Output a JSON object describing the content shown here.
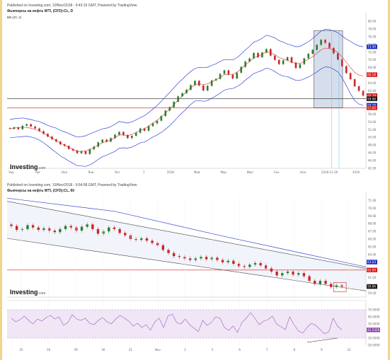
{
  "chart_data": [
    {
      "type": "candlestick",
      "published": "Published on Investing.com, 10/Nov/2018 - 9:43:16 GMT, Powered by TradingView",
      "title": "Фьючерсы на нефть WTI, (CFD):CL, D",
      "indicator": "BB (20, 2)",
      "logo": "Investing",
      "logo_suffix": ".com",
      "ylim": [
        42,
        80
      ],
      "y_ticks": [
        "80.00",
        "78.00",
        "76.00",
        "74.00",
        "72.00",
        "70.00",
        "68.00",
        "66.00",
        "64.00",
        "62.00",
        "60.00",
        "58.00",
        "56.00",
        "54.00",
        "52.00",
        "50.00",
        "48.00",
        "46.00",
        "44.00",
        "42.00"
      ],
      "x_ticks": [
        "Sep",
        "Авг",
        "Ноя",
        "Янв",
        "Окт",
        "7",
        "2018",
        "Май",
        "Мар",
        "Июл",
        "Сен",
        "Ноя",
        "2018-11-26",
        "2019"
      ],
      "price_labels": [
        {
          "text": "73.40",
          "value": 73.4,
          "color": "#1c2ec9"
        },
        {
          "text": "66.18",
          "value": 66.2,
          "color": "#d81b1b"
        },
        {
          "text": "60.78",
          "value": 60.78,
          "color": "#d81b1b"
        },
        {
          "text": "59.96",
          "value": 59.96,
          "color": "#111111"
        },
        {
          "text": "58.28",
          "value": 58.3,
          "color": "#1c2ec9"
        },
        {
          "text": "57.65",
          "value": 57.65,
          "color": "#d81b1b"
        }
      ],
      "horizontal_lines": [
        {
          "value": 59.96,
          "color": "#222222"
        },
        {
          "value": 57.65,
          "color": "#d81b1b"
        }
      ],
      "highlight_box": {
        "x_range": [
          0.855,
          0.935
        ],
        "y_range": [
          57.6,
          77.6
        ],
        "color": "#8aa1c7"
      },
      "closes": [
        52.2,
        52.6,
        52.1,
        53.0,
        53.4,
        52.8,
        52.3,
        51.6,
        50.9,
        50.2,
        49.5,
        48.9,
        48.2,
        47.8,
        47.0,
        46.6,
        45.9,
        46.4,
        45.7,
        46.9,
        47.6,
        48.7,
        49.4,
        48.9,
        49.8,
        50.7,
        51.4,
        50.6,
        49.8,
        50.4,
        51.2,
        52.3,
        51.7,
        52.9,
        53.6,
        54.3,
        55.5,
        56.9,
        57.8,
        59.2,
        60.6,
        61.4,
        62.3,
        63.5,
        64.6,
        63.4,
        62.1,
        63.3,
        64.7,
        65.1,
        66.4,
        67.3,
        66.2,
        65.2,
        66.7,
        68.2,
        69.6,
        70.4,
        71.8,
        70.7,
        71.9,
        72.8,
        71.1,
        70.0,
        68.9,
        69.9,
        70.7,
        69.3,
        67.9,
        68.9,
        70.4,
        71.6,
        72.6,
        73.9,
        75.2,
        74.4,
        73.1,
        71.7,
        70.1,
        68.4,
        66.6,
        65.0,
        63.2,
        62.0,
        60.78
      ],
      "bb_upper": [
        54.6,
        54.8,
        54.9,
        55.0,
        54.8,
        54.6,
        54.3,
        54.1,
        53.6,
        53.1,
        52.7,
        52.4,
        51.8,
        51.4,
        51.0,
        50.5,
        50.1,
        50.2,
        50.4,
        50.9,
        51.3,
        51.8,
        52.2,
        52.4,
        52.8,
        53.4,
        54.1,
        53.9,
        53.7,
        54.0,
        54.5,
        55.1,
        55.6,
        56.4,
        57.3,
        58.2,
        59.3,
        60.5,
        61.6,
        62.8,
        64.0,
        65.0,
        66.1,
        67.0,
        67.8,
        68.1,
        68.0,
        68.1,
        68.6,
        69.0,
        69.6,
        70.1,
        70.0,
        70.0,
        70.6,
        71.5,
        72.6,
        73.5,
        74.6,
        75.0,
        75.6,
        76.4,
        76.1,
        75.7,
        75.0,
        74.6,
        74.1,
        73.8,
        73.4,
        73.5,
        74.1,
        74.7,
        75.5,
        76.5,
        77.5,
        77.9,
        77.8,
        77.5,
        77.0,
        76.2,
        75.4,
        74.8,
        74.1,
        73.6,
        73.4
      ],
      "bb_lower": [
        49.9,
        50.0,
        50.1,
        50.2,
        50.3,
        50.1,
        49.8,
        49.3,
        48.6,
        47.8,
        46.9,
        46.1,
        45.2,
        44.6,
        43.9,
        43.3,
        42.7,
        42.6,
        42.5,
        42.9,
        43.5,
        44.3,
        45.0,
        45.4,
        45.9,
        46.4,
        47.2,
        47.3,
        47.2,
        47.5,
        48.0,
        48.6,
        48.8,
        49.4,
        50.1,
        50.6,
        51.3,
        52.1,
        53.0,
        54.1,
        55.3,
        56.4,
        57.4,
        58.5,
        59.4,
        59.5,
        59.3,
        59.5,
        60.1,
        60.7,
        61.4,
        62.2,
        62.5,
        62.6,
        63.1,
        63.8,
        64.8,
        65.6,
        66.5,
        66.9,
        67.3,
        67.9,
        67.6,
        67.0,
        66.3,
        65.8,
        65.7,
        65.2,
        64.7,
        64.7,
        65.1,
        65.6,
        66.2,
        66.9,
        67.7,
        68.2,
        68.1,
        67.6,
        66.9,
        65.4,
        63.4,
        61.3,
        59.5,
        58.6,
        58.28
      ]
    },
    {
      "type": "candlestick",
      "published": "Published on Investing.com, 10/Nov/2018 - 9:54:58 GMT, Powered by TradingView",
      "title": "Фьючерсы на нефть WTI, (CFD):CL, 60",
      "logo": "Investing",
      "logo_suffix": ".com",
      "ylim": [
        58.5,
        71.5
      ],
      "y_ticks": [
        "71.00",
        "70.00",
        "69.00",
        "68.00",
        "67.00",
        "66.00",
        "65.00",
        "64.00",
        "63.00",
        "62.00",
        "61.00",
        "60.00",
        "59.00"
      ],
      "x_ticks": [
        "25",
        "26",
        "29",
        "30",
        "31",
        "Nov",
        "2",
        "5",
        "6",
        "7",
        "8",
        "9",
        "12"
      ],
      "price_labels": [
        {
          "text": "63.03",
          "value": 63.03,
          "color": "#1c2ec9"
        },
        {
          "text": "62.00",
          "value": 62.0,
          "color": "#d81b1b"
        },
        {
          "text": "59.86",
          "value": 59.86,
          "color": "#111111"
        }
      ],
      "horizontal_lines": [
        {
          "value": 62.0,
          "color": "#d81b1b"
        }
      ],
      "closes": [
        67.7,
        67.2,
        67.3,
        67.8,
        67.5,
        67.2,
        67.4,
        67.1,
        66.9,
        67.3,
        67.7,
        67.5,
        67.1,
        67.6,
        67.9,
        67.3,
        66.7,
        67.0,
        67.5,
        67.3,
        66.8,
        66.5,
        66.0,
        65.9,
        66.1,
        65.8,
        65.5,
        65.2,
        64.6,
        64.2,
        63.8,
        63.7,
        63.5,
        63.3,
        63.5,
        63.7,
        63.4,
        63.6,
        63.3,
        63.0,
        63.2,
        62.8,
        62.5,
        62.4,
        62.7,
        62.9,
        62.6,
        62.2,
        61.8,
        61.3,
        61.6,
        61.8,
        61.4,
        61.6,
        61.2,
        60.6,
        60.2,
        60.6,
        60.2,
        59.8,
        60.0,
        59.86
      ],
      "channel_upper": [
        [
          0,
          70.9
        ],
        [
          1,
          62.2
        ]
      ],
      "channel_lower": [
        [
          0,
          66.1
        ],
        [
          1,
          59.3
        ]
      ],
      "ma_line": [
        [
          0,
          71.3
        ],
        [
          0.3,
          69.6
        ],
        [
          0.6,
          66.4
        ],
        [
          0.8,
          64.4
        ],
        [
          1,
          62.4
        ]
      ],
      "highlight_box": {
        "x_range": [
          0.91,
          0.945
        ],
        "y_range": [
          59.2,
          60.4
        ],
        "color": "#c62828"
      }
    },
    {
      "type": "line",
      "name": "RSI",
      "ylim": [
        20,
        80
      ],
      "y_ticks": [
        "70.0000",
        "60.0000",
        "50.0000",
        "40.0000",
        "30.0000",
        "20.0000"
      ],
      "value_label": "41.5356",
      "value": 41.5356,
      "levels": [
        30,
        70
      ],
      "values": [
        58,
        53,
        56,
        61,
        55,
        50,
        57,
        54,
        59,
        62,
        57,
        60,
        48,
        52,
        63,
        57,
        55,
        58,
        51,
        49,
        55,
        59,
        53,
        50,
        57,
        62,
        58,
        54,
        47,
        51,
        45,
        49,
        41,
        53,
        58,
        45,
        61,
        64,
        52,
        50,
        57,
        49,
        44,
        39,
        55,
        48,
        52,
        60,
        58,
        45,
        41,
        47,
        38,
        52,
        58,
        66,
        58,
        49,
        54,
        56,
        61,
        50,
        46,
        42,
        60,
        49,
        40,
        37,
        45,
        51,
        48,
        42,
        36,
        39,
        58,
        47,
        41.5
      ]
    }
  ]
}
